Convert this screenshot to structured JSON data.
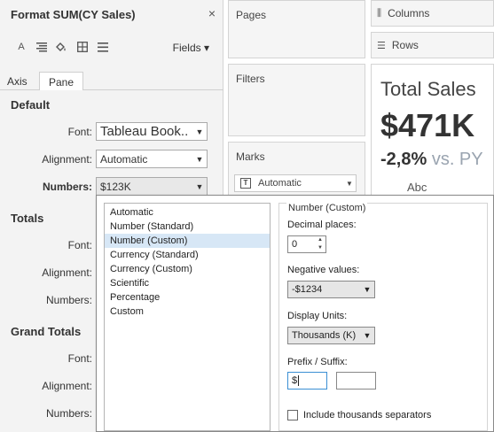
{
  "format_pane": {
    "title": "Format SUM(CY Sales)",
    "close_glyph": "×",
    "toolbar": {
      "icons": [
        "font-icon",
        "align-icon",
        "fill-bucket-icon",
        "borders-icon",
        "lines-icon"
      ],
      "font_glyph": "A",
      "fields_label": "Fields",
      "fields_chevron": "▾"
    },
    "tabs": [
      {
        "label": "Axis",
        "active": false
      },
      {
        "label": "Pane",
        "active": true
      }
    ],
    "sections": {
      "default": {
        "heading": "Default",
        "font_label": "Font:",
        "font_value": "Tableau Book..",
        "alignment_label": "Alignment:",
        "alignment_value": "Automatic",
        "numbers_label": "Numbers:",
        "numbers_value": "$123K"
      },
      "totals": {
        "heading": "Totals",
        "font_label": "Font:",
        "alignment_label": "Alignment:",
        "numbers_label": "Numbers:"
      },
      "grand_totals": {
        "heading": "Grand Totals",
        "font_label": "Font:",
        "alignment_label": "Alignment:",
        "numbers_label": "Numbers:"
      }
    }
  },
  "shelves": {
    "pages_label": "Pages",
    "filters_label": "Filters",
    "marks_label": "Marks",
    "marks_type": "Automatic",
    "marks_type_glyph": "T",
    "columns_label": "Columns",
    "rows_label": "Rows",
    "columns_glyph": "⫼",
    "rows_glyph": "☰"
  },
  "view": {
    "title": "Total Sales",
    "value": "$471K",
    "delta_pct": "-2,8%",
    "delta_vs": "vs. PY",
    "marks_text": "Abc"
  },
  "number_format": {
    "list": [
      {
        "label": "Automatic",
        "selected": false
      },
      {
        "label": "Number (Standard)",
        "selected": false
      },
      {
        "label": "Number (Custom)",
        "selected": true
      },
      {
        "label": "Currency (Standard)",
        "selected": false
      },
      {
        "label": "Currency (Custom)",
        "selected": false
      },
      {
        "label": "Scientific",
        "selected": false
      },
      {
        "label": "Percentage",
        "selected": false
      },
      {
        "label": "Custom",
        "selected": false
      }
    ],
    "options": {
      "legend": "Number (Custom)",
      "decimal_places_label": "Decimal places:",
      "decimal_places_value": "0",
      "negative_values_label": "Negative values:",
      "negative_values_value": "-$1234",
      "display_units_label": "Display Units:",
      "display_units_value": "Thousands (K)",
      "prefix_suffix_label": "Prefix / Suffix:",
      "prefix_value": "$",
      "suffix_value": "",
      "thousands_separator_label": "Include thousands separators",
      "thousands_separator_checked": false
    }
  },
  "colors": {
    "pane_bg": "#f3f3f3",
    "selected_item": "#d7e7f6",
    "accent_border": "#3b8fd4",
    "vs_text": "#9aa4b0"
  }
}
